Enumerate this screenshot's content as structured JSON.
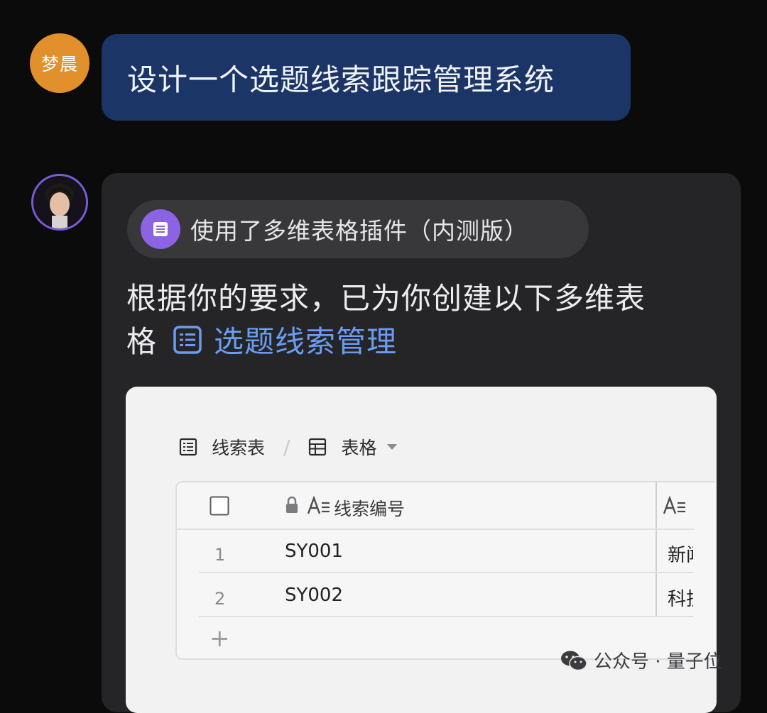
{
  "user": {
    "avatar_text": "梦晨",
    "message": "设计一个选题线索跟踪管理系统"
  },
  "bot": {
    "plugin_label": "使用了多维表格插件（内测版）",
    "reply_line1": "根据你的要求，已为你创建以下多维表",
    "reply_line2_prefix": "格",
    "link_text": "选题线索管理"
  },
  "table_card": {
    "tabs": {
      "sheet_name": "线索表",
      "view_name": "表格"
    },
    "column_header": "线索编号",
    "rows": [
      {
        "index": "1",
        "id": "SY001",
        "next_col": "新闻"
      },
      {
        "index": "2",
        "id": "SY002",
        "next_col": "科技"
      }
    ],
    "add_row_label": "+"
  },
  "watermark": "公众号 · 量子位",
  "colors": {
    "user_bubble": "#1b3567",
    "plugin_icon": "#8b63e3",
    "link": "#6c9cf2"
  }
}
